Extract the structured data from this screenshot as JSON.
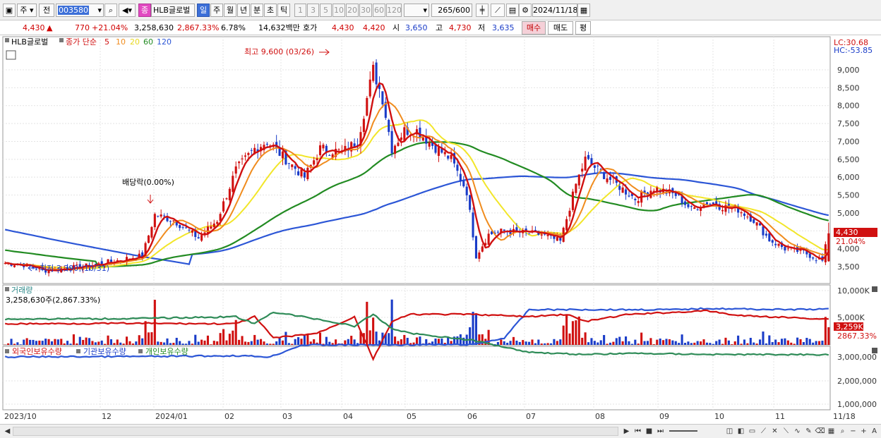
{
  "toolbar": {
    "market": "주",
    "prev": "전",
    "code": "003580",
    "category_badge": "종",
    "stock_name": "HLB글로벌",
    "periods": [
      "일",
      "주",
      "월",
      "년",
      "분",
      "초",
      "틱"
    ],
    "selected_period": "일",
    "intervals": [
      "1",
      "3",
      "5",
      "10",
      "20",
      "30",
      "60",
      "120"
    ],
    "count": "265",
    "count_total": "/600",
    "date": "2024/11/18"
  },
  "quote": {
    "price": "4,430",
    "change_arrow": "▲",
    "change": "770",
    "change_rate": "+21.04%",
    "volume": "3,258,630",
    "volume_rate": "2,867.33%",
    "turnover": "6.78%",
    "amount": "14,632백만",
    "hoga_label": "호가",
    "ask": "4,430",
    "bid": "4,420",
    "open_label": "시",
    "open": "3,650",
    "high_label": "고",
    "high": "4,730",
    "low_label": "저",
    "low": "3,635",
    "buy_btn": "매수",
    "sell_btn": "매도",
    "eval_btn": "평"
  },
  "price_panel": {
    "legend_name": "HLB글로벌",
    "legend_ma_label": "종가 단순",
    "ma_periods": [
      "5",
      "10",
      "20",
      "60",
      "120"
    ],
    "ma_colors": {
      "5": "#d01010",
      "10": "#f08c1e",
      "20": "#f2e62a",
      "60": "#228b22",
      "120": "#2c56d6"
    },
    "lc": "LC:30.68",
    "hc": "HC:-53.85",
    "y_ticks": [
      "9,000",
      "8,500",
      "8,000",
      "7,500",
      "7,000",
      "6,500",
      "6,000",
      "5,500",
      "5,000",
      "4,500",
      "4,000",
      "3,500"
    ],
    "current_tag": "4,430",
    "current_rate_tag": "21.04%",
    "ann_high": "최고 9,600 (03/26)",
    "ann_low": "최저 3,390 (10/31)",
    "ann_dividend": "배당락(0.00%)"
  },
  "volume_panel": {
    "title": "거래량",
    "value": "3,258,630주(2,867.33%)",
    "y_ticks": [
      "10,000K",
      "5,000K"
    ],
    "current_tag": "3,259K",
    "current_rate_tag": "2867.33%"
  },
  "holding_panel": {
    "legend": [
      "외국인보유수량",
      "기관보유수량",
      "개인보유수량"
    ],
    "y_ticks": [
      "3,000,000",
      "2,000,000",
      "1,000,000"
    ]
  },
  "x_axis": [
    "2023/10",
    "12",
    "2024/01",
    "02",
    "03",
    "04",
    "05",
    "06",
    "07",
    "08",
    "09",
    "10",
    "11",
    "11/18"
  ],
  "chart_data": {
    "type": "candlestick",
    "x_range": [
      "2023/10",
      "2024/11/18"
    ],
    "price_ylim": [
      3300,
      9500
    ],
    "price_points": [
      {
        "date": "2023/10",
        "close": 3600
      },
      {
        "date": "2023/10/31",
        "close": 3390,
        "note": "최저"
      },
      {
        "date": "2023/12",
        "close": 3750
      },
      {
        "date": "2024/01",
        "close": 4950
      },
      {
        "date": "2024/02",
        "close": 7200
      },
      {
        "date": "2024/03",
        "close": 6800
      },
      {
        "date": "2024/03/26",
        "close": 9600,
        "note": "최고"
      },
      {
        "date": "2024/04",
        "close": 7200
      },
      {
        "date": "2024/05",
        "close": 5200
      },
      {
        "date": "2024/06",
        "close": 4450
      },
      {
        "date": "2024/07",
        "close": 6300
      },
      {
        "date": "2024/08",
        "close": 5500
      },
      {
        "date": "2024/09",
        "close": 5200
      },
      {
        "date": "2024/10",
        "close": 4900
      },
      {
        "date": "2024/11",
        "close": 3900
      },
      {
        "date": "2024/11/18",
        "open": 3650,
        "high": 4730,
        "low": 3635,
        "close": 4430
      }
    ],
    "volume_ylim": [
      0,
      10000000
    ],
    "volume_last": 3258630,
    "holding_ylim": [
      700000,
      3200000
    ]
  }
}
